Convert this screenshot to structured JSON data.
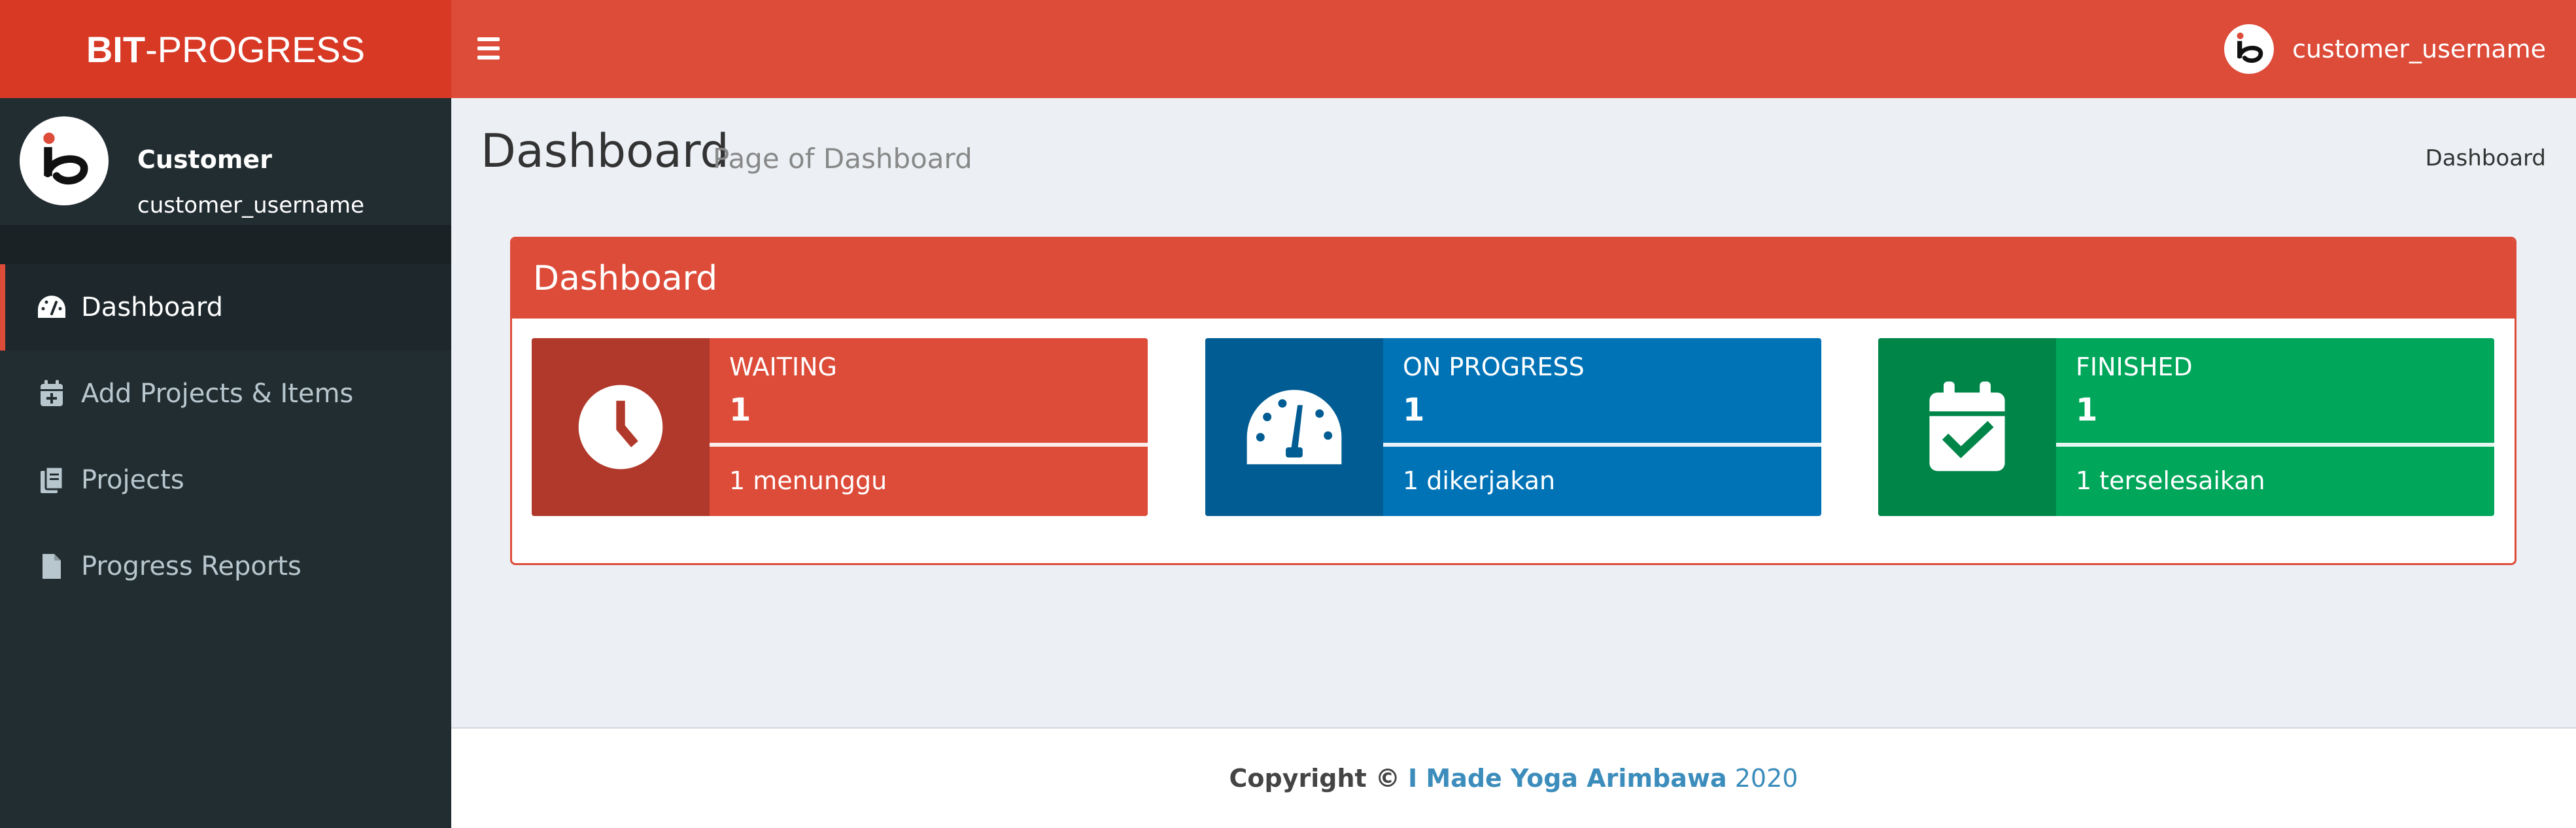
{
  "header": {
    "logo_bold": "BIT",
    "logo_rest": "-PROGRESS",
    "user_name": "customer_username"
  },
  "sidebar": {
    "user_role": "Customer",
    "user_name": "customer_username",
    "items": [
      {
        "label": "Dashboard",
        "icon": "tachometer-icon",
        "active": true
      },
      {
        "label": "Add Projects & Items",
        "icon": "calendar-plus-icon",
        "active": false
      },
      {
        "label": "Projects",
        "icon": "files-icon",
        "active": false
      },
      {
        "label": "Progress Reports",
        "icon": "file-icon",
        "active": false
      }
    ]
  },
  "content_header": {
    "title": "Dashboard",
    "subtitle": "Page of Dashboard",
    "breadcrumb": "Dashboard"
  },
  "box": {
    "title": "Dashboard",
    "cards": [
      {
        "label": "WAITING",
        "number": "1",
        "description": "1 menunggu",
        "icon": "clock-icon",
        "color": "#dd4b39",
        "icon_bg": "#b0392b"
      },
      {
        "label": "ON PROGRESS",
        "number": "1",
        "description": "1 dikerjakan",
        "icon": "speedometer-icon",
        "color": "#0073b7",
        "icon_bg": "#005c92"
      },
      {
        "label": "FINISHED",
        "number": "1",
        "description": "1 terselesaikan",
        "icon": "calendar-check-icon",
        "color": "#00a65a",
        "icon_bg": "#008548"
      }
    ]
  },
  "footer": {
    "prefix": "Copyright ©",
    "author": "I Made Yoga Arimbawa",
    "year": "2020"
  },
  "colors": {
    "header_red": "#dd4b39",
    "logo_red": "#d73925",
    "sidebar_dark": "#222d32",
    "content_bg": "#ecf0f5",
    "link_blue": "#3c8dbc"
  }
}
